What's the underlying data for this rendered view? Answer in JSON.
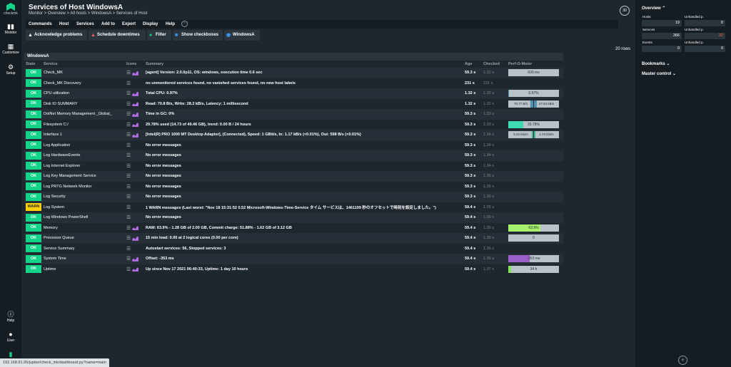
{
  "nav": {
    "logo_text": "checkmk",
    "monitor": "Monitor",
    "customize": "Customize",
    "setup": "Setup",
    "help": "Help",
    "user": "User"
  },
  "header": {
    "title": "Services of Host WindowsA",
    "breadcrumb": [
      "Monitor",
      "Overview",
      "All hosts",
      "WindowsA",
      "Services of Host"
    ],
    "refresh": "30"
  },
  "menu": [
    "Commands",
    "Host",
    "Services",
    "Add to",
    "Export",
    "Display",
    "Help"
  ],
  "toolbar": {
    "ack": "Acknowledge problems",
    "downtime": "Schedule downtimes",
    "filter": "Filter",
    "checkboxes": "Show checkboxes",
    "host": "WindowsA"
  },
  "rows_count": "20 rows",
  "table": {
    "caption": "WindowsA",
    "columns": [
      "State",
      "Service",
      "Icons",
      "Summary",
      "Age",
      "Checked",
      "Perf-O-Meter"
    ],
    "rows": [
      {
        "state": "OK",
        "service": "Check_MK",
        "graph": true,
        "summary": "[agent] Version: 2.0.0p11, OS: windows, execution time 0.6 sec",
        "age": "59.3 s",
        "checked": "1.31 s",
        "perf": "600 ms"
      },
      {
        "state": "OK",
        "service": "Check_MK Discovery",
        "graph": false,
        "summary": "no unmonitored services found, no vanished services found, no new host labels",
        "age": "231 s",
        "checked": "231 s",
        "perf": ""
      },
      {
        "state": "OK",
        "service": "CPU utilization",
        "graph": true,
        "summary": "Total CPU: 0.97%",
        "age": "1.32 s",
        "checked": "1.32 s",
        "perf": "0.97%"
      },
      {
        "state": "OK",
        "service": "Disk IO SUMMARY",
        "graph": true,
        "summary": "Read: 70.8 B/s, Write: 28.2 kB/s, Latency: 1 millisecond",
        "age": "1.32 s",
        "checked": "1.32 s",
        "perf_left": "70.77 B/s",
        "perf_right": "27.64 kB/s"
      },
      {
        "state": "OK",
        "service": "DotNet Memory Management _Global_",
        "graph": true,
        "summary": "Time in GC: 0%",
        "age": "59.3 s",
        "checked": "1.33 s",
        "perf": ""
      },
      {
        "state": "OK",
        "service": "Filesystem C:/",
        "graph": true,
        "summary": "29.78% used (14.73 of 49.46 GB), trend: 0.00 B / 24 hours",
        "age": "59.3 s",
        "checked": "1.33 s",
        "perf": "29.78%"
      },
      {
        "state": "OK",
        "service": "Interface 1",
        "graph": true,
        "summary": "[Intel(R) PRO 1000 MT Desktop Adapter], (Connected), Speed: 1 GBit/s, In: 1.17 kB/s (<0.01%), Out: 598 B/s (<0.01%)",
        "age": "59.3 s",
        "checked": "1.34 s",
        "perf_left": "9.32 kbit/s",
        "perf_right": "4.78 kbit/s"
      },
      {
        "state": "OK",
        "service": "Log Application",
        "graph": false,
        "summary": "No error messages",
        "age": "59.3 s",
        "checked": "1.34 s",
        "perf": ""
      },
      {
        "state": "OK",
        "service": "Log HardwareEvents",
        "graph": false,
        "summary": "No error messages",
        "age": "59.3 s",
        "checked": "1.34 s",
        "perf": ""
      },
      {
        "state": "OK",
        "service": "Log Internet Explorer",
        "graph": false,
        "summary": "No error messages",
        "age": "59.3 s",
        "checked": "1.34 s",
        "perf": ""
      },
      {
        "state": "OK",
        "service": "Log Key Management Service",
        "graph": false,
        "summary": "No error messages",
        "age": "59.3 s",
        "checked": "1.35 s",
        "perf": ""
      },
      {
        "state": "OK",
        "service": "Log PRTG Network Monitor",
        "graph": false,
        "summary": "No error messages",
        "age": "59.3 s",
        "checked": "1.35 s",
        "perf": ""
      },
      {
        "state": "OK",
        "service": "Log Security",
        "graph": false,
        "summary": "No error messages",
        "age": "59.3 s",
        "checked": "1.35 s",
        "perf": ""
      },
      {
        "state": "WARN",
        "service": "Log System",
        "graph": false,
        "summary": "1 WARN messages (Last worst: \"Nov 18 15:31:52 0.52 Microsoft-Windows-Time-Service タイム サービスは、1461199 秒のオフセットで時刻を設定しました。\")",
        "age": "59.4 s",
        "checked": "1.35 s",
        "perf": ""
      },
      {
        "state": "OK",
        "service": "Log Windows PowerShell",
        "graph": false,
        "summary": "No error messages",
        "age": "59.4 s",
        "checked": "1.35 s",
        "perf": ""
      },
      {
        "state": "OK",
        "service": "Memory",
        "graph": true,
        "summary": "RAM: 63.9% - 1.28 GB of 2.00 GB, Commit charge: 51.88% - 1.62 GB of 3.12 GB",
        "age": "59.4 s",
        "checked": "1.36 s",
        "perf": "63.9%"
      },
      {
        "state": "OK",
        "service": "Processor Queue",
        "graph": true,
        "summary": "15 min load: 0.00 at 2 logical cores (0.00 per core)",
        "age": "59.4 s",
        "checked": "1.36 s",
        "perf": "0"
      },
      {
        "state": "OK",
        "service": "Service Summary",
        "graph": false,
        "summary": "Autostart services: 56, Stopped services: 3",
        "age": "59.4 s",
        "checked": "1.36 s",
        "perf": ""
      },
      {
        "state": "OK",
        "service": "System Time",
        "graph": true,
        "summary": "Offset: -353 ms",
        "age": "59.4 s",
        "checked": "1.36 s",
        "perf": "-353 ms"
      },
      {
        "state": "OK",
        "service": "Uptime",
        "graph": true,
        "summary": "Up since Nov 17 2021 06:40:33, Uptime: 1 day 10 hours",
        "age": "59.4 s",
        "checked": "1.37 s",
        "perf": "34 h"
      }
    ],
    "perf_fill": {
      "Check_MK": 0.0,
      "CPU utilization": 0.01,
      "Disk IO SUMMARY": 0.1,
      "Filesystem C:/": 0.2978,
      "Interface 1": 0.05,
      "Memory": 0.639,
      "System Time": 0.42,
      "Uptime": 0.05
    },
    "perf_colors": {
      "Filesystem C:/": "#3fd9b3",
      "Memory": "#a6f06e",
      "System Time": "#9b5fc7",
      "Uptime": "#84e45a",
      "Disk IO SUMMARY": "#4f8fb0",
      "Interface 1": "#3fb58a"
    }
  },
  "sidebar": {
    "overview_title": "Overview",
    "hosts_label": "Hosts",
    "hosts_value": "19",
    "hosts_unh_label": "Unhandled p.",
    "hosts_unh_value": "0",
    "services_label": "Services",
    "services_value": "366",
    "services_unh_label": "Unhandled p.",
    "services_unh_value": "32",
    "events_label": "Events",
    "events_value": "0",
    "events_unh_label": "Unhandled p.",
    "events_unh_value": "0",
    "bookmarks": "Bookmarks",
    "master_control": "Master control"
  },
  "status_url": "192.168.91.95/jupiter/check_mk/dashboard.py?name=main"
}
